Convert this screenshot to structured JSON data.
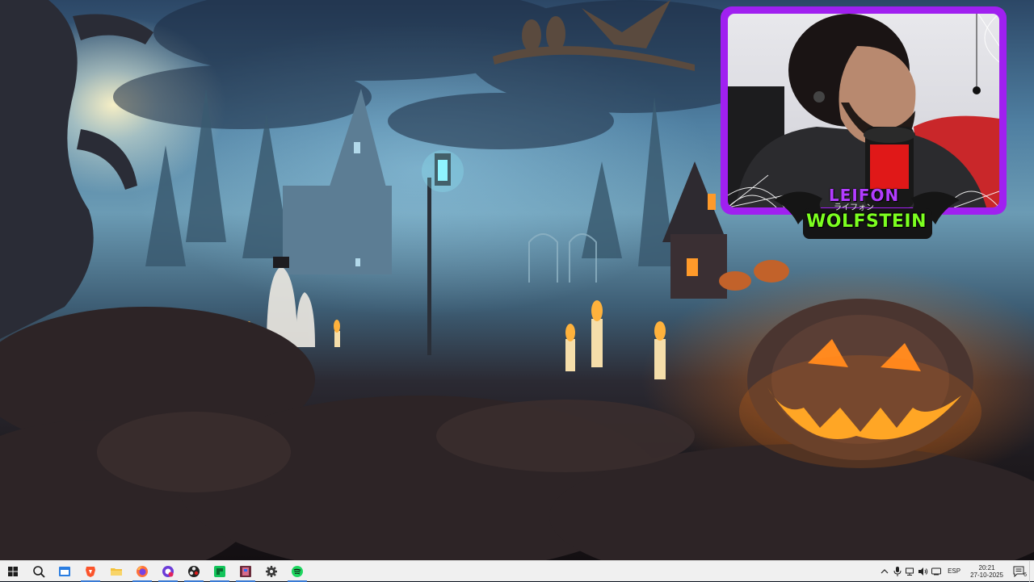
{
  "webcam": {
    "logo_top": "LEIFON",
    "logo_kana": "ライフォン",
    "logo_bottom": "WOLFSTEIN"
  },
  "taskbar": {
    "items": [
      {
        "name": "start-button",
        "icon": "windows-logo-icon"
      },
      {
        "name": "search-button",
        "icon": "search-icon"
      },
      {
        "name": "taskbar-app-1",
        "icon": "blue-window-app-icon"
      },
      {
        "name": "taskbar-brave",
        "icon": "brave-browser-icon"
      },
      {
        "name": "taskbar-file-explorer",
        "icon": "folder-icon"
      },
      {
        "name": "taskbar-firefox",
        "icon": "firefox-icon"
      },
      {
        "name": "taskbar-app-purple",
        "icon": "purple-circle-app-icon"
      },
      {
        "name": "taskbar-obs",
        "icon": "obs-studio-icon"
      },
      {
        "name": "taskbar-app-green",
        "icon": "green-app-icon"
      },
      {
        "name": "taskbar-app-game",
        "icon": "game-app-icon"
      },
      {
        "name": "taskbar-settings",
        "icon": "gear-icon"
      },
      {
        "name": "taskbar-spotify",
        "icon": "spotify-icon"
      }
    ],
    "tray": {
      "language": "ESP",
      "time": "20:21",
      "date": "27-10-2025",
      "notification_count": "6"
    }
  }
}
